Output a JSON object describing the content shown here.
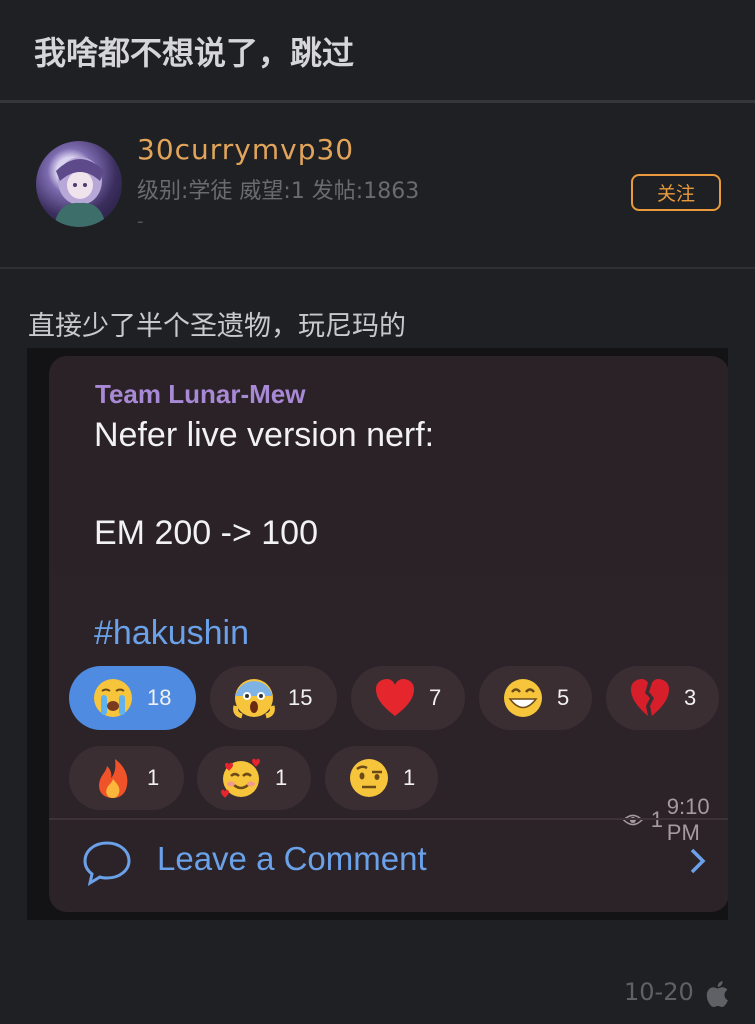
{
  "header": {
    "title": "我啥都不想说了，跳过"
  },
  "user": {
    "name": "30currymvp30",
    "stats": "级别:学徒 威望:1 发帖:1863",
    "signature": "-",
    "follow_label": "关注"
  },
  "post": {
    "text": "直接少了半个圣遗物，玩尼玛的",
    "screenshot": {
      "channel": "Team Lunar-Mew",
      "lines": [
        "Nefer live version nerf:",
        "EM 200 -> 100",
        "#hakushin"
      ],
      "reactions": [
        {
          "icon": "crying-face-emoji",
          "count": "18",
          "active": true
        },
        {
          "icon": "screaming-face-emoji",
          "count": "15",
          "active": false
        },
        {
          "icon": "red-heart-emoji",
          "count": "7",
          "active": false
        },
        {
          "icon": "grinning-face-emoji",
          "count": "5",
          "active": false
        },
        {
          "icon": "broken-heart-emoji",
          "count": "3",
          "active": false
        },
        {
          "icon": "fire-emoji",
          "count": "1",
          "active": false
        },
        {
          "icon": "smiling-face-with-hearts-emoji",
          "count": "1",
          "active": false
        },
        {
          "icon": "raised-eyebrow-face-emoji",
          "count": "1",
          "active": false
        }
      ],
      "views": "1",
      "time": "9:10 PM",
      "comment_label": "Leave a Comment"
    }
  },
  "footer": {
    "date": "10-20",
    "platform_icon": "apple-icon"
  },
  "colors": {
    "background": "#1f2023",
    "username": "#e2a45a",
    "follow": "#e89a3c",
    "link": "#6aa1e8",
    "channel": "#a889d6",
    "active_reaction": "#4f8be0"
  }
}
